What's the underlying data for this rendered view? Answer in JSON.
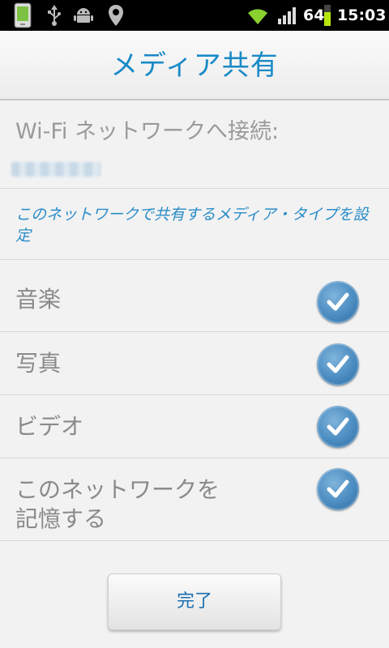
{
  "status_bar": {
    "battery_level": "64",
    "time": "15:03",
    "icons": [
      "phone-screen-icon",
      "usb-icon",
      "android-debug-icon",
      "location-pin-icon",
      "wifi-signal-icon",
      "cell-signal-icon",
      "battery-icon"
    ]
  },
  "title_bar": {
    "title": "メディア共有"
  },
  "connection": {
    "label": "Wi-Fi ネットワークへ接続:"
  },
  "description": "このネットワークで共有するメディア・タイプを設定",
  "options": [
    {
      "label": "音楽",
      "checked": true
    },
    {
      "label": "写真",
      "checked": true
    },
    {
      "label": "ビデオ",
      "checked": true
    },
    {
      "label_line1": "このネットワークを",
      "label_line2": "記憶する",
      "checked": true
    }
  ],
  "done_button": {
    "label": "完了"
  },
  "colors": {
    "accent": "#1a8ac7",
    "check_blue": "#4a8bc0",
    "label_gray": "#8a8a8a"
  }
}
